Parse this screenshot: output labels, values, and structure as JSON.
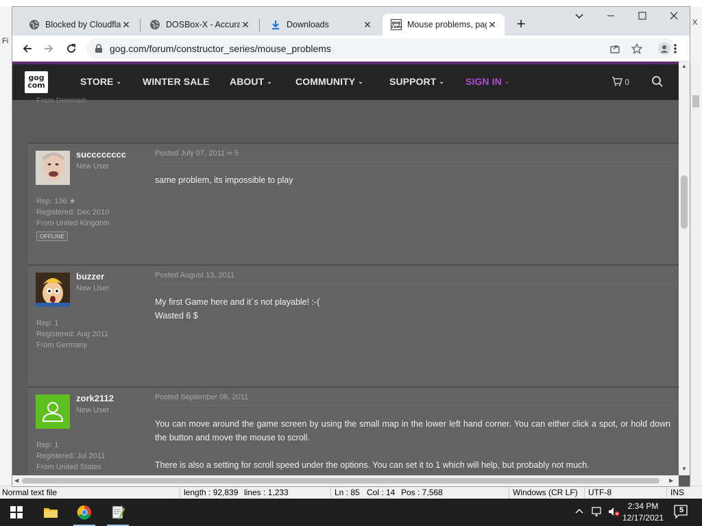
{
  "chrome": {
    "tabs": [
      {
        "title": "Blocked by Cloudflare",
        "active": false
      },
      {
        "title": "DOSBox-X - Accurate",
        "active": false
      },
      {
        "title": "Downloads",
        "active": false
      },
      {
        "title": "Mouse problems, pag",
        "active": true
      }
    ],
    "url": "gog.com/forum/constructor_series/mouse_problems"
  },
  "gog_nav": {
    "logo_top": "gog",
    "logo_bottom": "com",
    "items": [
      {
        "label": "STORE",
        "dropdown": true
      },
      {
        "label": "WINTER SALE",
        "dropdown": false
      },
      {
        "label": "ABOUT",
        "dropdown": true
      },
      {
        "label": "COMMUNITY",
        "dropdown": true
      },
      {
        "label": "SUPPORT",
        "dropdown": true
      },
      {
        "label": "SIGN IN",
        "dropdown": true
      }
    ],
    "cart_count": "0",
    "sign_in_color": "#b24bd6"
  },
  "prev_post_tail": {
    "location": "From Denmark"
  },
  "posts": [
    {
      "username": "succcccccc",
      "rank": "New User",
      "rep": "Rep: 136",
      "registered": "Registered: Dec 2010",
      "location": "From United Kingdom",
      "status": "OFFLINE",
      "posted": "Posted July 07, 2011",
      "likes": "5",
      "body": [
        "same problem, its impossible to play"
      ]
    },
    {
      "username": "buzzer",
      "rank": "New User",
      "rep": "Rep: 1",
      "registered": "Registered: Aug 2011",
      "location": "From Germany",
      "posted": "Posted August 13, 2011",
      "body": [
        "My first Game here and it´s not playable! :-(",
        "Wasted 6 $"
      ]
    },
    {
      "username": "zork2112",
      "rank": "New User",
      "rep": "Rep: 1",
      "registered": "Registered: Jul 2011",
      "location": "From United States",
      "posted": "Posted September 08, 2011",
      "body": [
        "You can move around the game screen by using the small map in the lower left hand corner. You can either click a spot, or hold down the button and move the mouse to scroll.",
        "There is also a setting for scroll speed under the options. You can set it to 1 which will help, but probably not much."
      ]
    }
  ],
  "background_app": {
    "left_menu_fragment": "Fi",
    "right_fragment": "X"
  },
  "statusbar": {
    "type": "Normal text file",
    "length": "length : 92,839",
    "lines": "lines : 1,233",
    "ln": "Ln : 85",
    "col": "Col : 14",
    "pos": "Pos : 7,568",
    "eol": "Windows (CR LF)",
    "encoding": "UTF-8",
    "mode": "INS"
  },
  "taskbar": {
    "time": "2:34 PM",
    "date": "12/17/2021",
    "notification_count": "5"
  }
}
